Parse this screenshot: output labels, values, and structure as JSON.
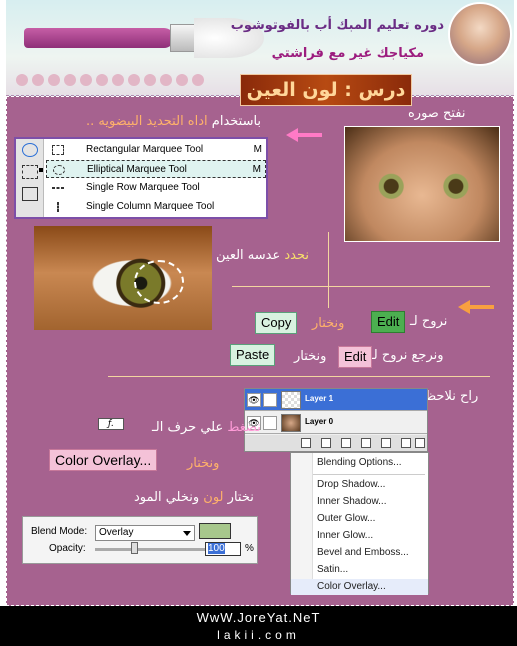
{
  "header": {
    "line1": "دوره تعليم المبك أب بالفوتوشوب",
    "line2": "مكياجك غير مع فراشتي",
    "lesson_title": "درس : لون العين"
  },
  "steps": {
    "open_image": "نفتح صوره",
    "using_tool_prefix": "باستخدام",
    "using_tool_highlight": "اداه التحديد البيضويه ..",
    "eye_lens_highlight": "نحدد",
    "eye_lens_rest": "عدسه العين",
    "go_to": "نروح لـ",
    "choose": "ونختار",
    "return_to": "ونرجع نروح لـ",
    "new_layer_note": "راح نلاحظ ظهور لير جديد",
    "press_highlight": "نضغط",
    "press_rest": "علي حرف الـ",
    "choose_overlay": "ونختار",
    "choose_color_a": "نختار",
    "choose_color_highlight": "لون",
    "choose_color_b": "ونخلي المود"
  },
  "tool_menu": {
    "items": [
      {
        "label": "Rectangular Marquee Tool",
        "key": "M"
      },
      {
        "label": "Elliptical Marquee Tool",
        "key": "M"
      },
      {
        "label": "Single Row Marquee Tool",
        "key": ""
      },
      {
        "label": "Single Column Marquee Tool",
        "key": ""
      }
    ]
  },
  "buttons": {
    "copy": "Copy",
    "edit": "Edit",
    "paste": "Paste",
    "color_overlay": "Color Overlay..."
  },
  "fx_icon_label": "ƒ.",
  "layers_panel": {
    "layers": [
      {
        "name": "Layer 1"
      },
      {
        "name": "Layer 0"
      }
    ]
  },
  "context_menu": {
    "items": [
      "Blending Options...",
      "Drop Shadow...",
      "Inner Shadow...",
      "Outer Glow...",
      "Inner Glow...",
      "Bevel and Emboss...",
      "Satin...",
      "Color Overlay..."
    ]
  },
  "blend_panel": {
    "blend_mode_label": "Blend Mode:",
    "blend_mode_value": "Overlay",
    "opacity_label": "Opacity:",
    "opacity_value": "100",
    "opacity_unit": "%",
    "overlay_color": "#a7c78c"
  },
  "footer": {
    "line1": "WwW.JoreYat.NeT",
    "line2": "lakii.com"
  },
  "colors": {
    "background": "#a6628f",
    "accent_pink": "#ff9cd8",
    "accent_yellow": "#f8e06a"
  }
}
